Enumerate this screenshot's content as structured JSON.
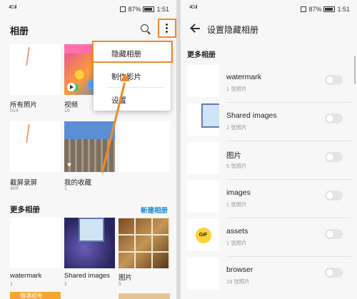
{
  "status": {
    "signal": "4G ıll",
    "battery": "87%",
    "time": "1:51"
  },
  "left": {
    "title": "相册",
    "albums_top": [
      {
        "label": "所有照片",
        "count": "514"
      },
      {
        "label": "视频",
        "count": "10"
      },
      {
        "label": "截屏录屏",
        "count": "469"
      },
      {
        "label": "我的收藏",
        "count": "1"
      }
    ],
    "more_section_title": "更多相册",
    "new_album_label": "新建相册",
    "albums_more": [
      {
        "label": "watermark",
        "count": "1"
      },
      {
        "label": "Shared images",
        "count": "2"
      },
      {
        "label": "图片",
        "count": "5"
      }
    ],
    "menu": [
      "隐藏相册",
      "制作影片",
      "设置"
    ],
    "bottom_peek_text": "情满初冬"
  },
  "right": {
    "title": "设置隐藏相册",
    "section_title": "更多相册",
    "albums": [
      {
        "name": "watermark",
        "count": "1 张照片"
      },
      {
        "name": "Shared images",
        "count": "2 张照片"
      },
      {
        "name": "图片",
        "count": "5 张照片"
      },
      {
        "name": "images",
        "count": "1 张照片"
      },
      {
        "name": "assets",
        "count": "1 张照片"
      },
      {
        "name": "browser",
        "count": "18 张照片"
      }
    ],
    "gif_badge": "GIF"
  },
  "colors": {
    "highlight": "#ef8a2c",
    "link": "#1a8cd8",
    "toggle_off": "#e5e5e5"
  }
}
